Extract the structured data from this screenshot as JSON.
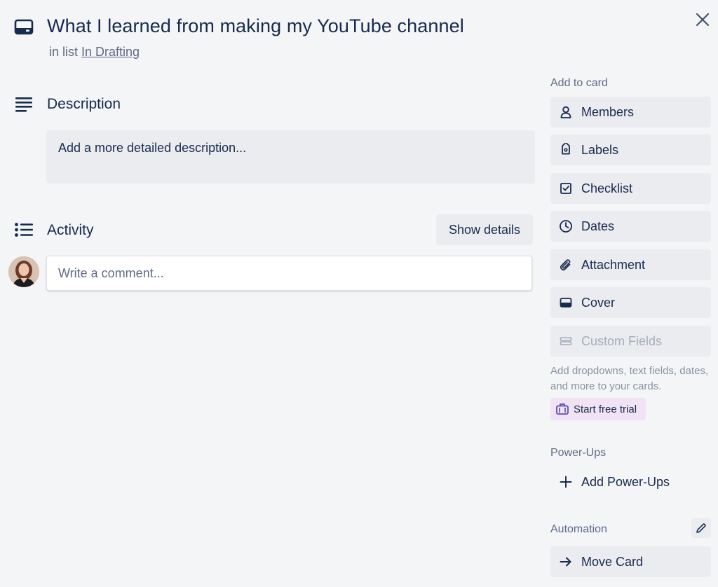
{
  "card": {
    "title": "What I learned from making my YouTube channel",
    "in_list_prefix": "in list",
    "list_name": "In Drafting"
  },
  "description": {
    "heading": "Description",
    "placeholder": "Add a more detailed description..."
  },
  "activity": {
    "heading": "Activity",
    "show_details_label": "Show details",
    "comment_placeholder": "Write a comment..."
  },
  "sidebar": {
    "add_to_card_heading": "Add to card",
    "buttons": [
      {
        "label": "Members",
        "icon": "person-icon"
      },
      {
        "label": "Labels",
        "icon": "tag-icon"
      },
      {
        "label": "Checklist",
        "icon": "checkbox-icon"
      },
      {
        "label": "Dates",
        "icon": "clock-icon"
      },
      {
        "label": "Attachment",
        "icon": "paperclip-icon"
      },
      {
        "label": "Cover",
        "icon": "cover-icon"
      },
      {
        "label": "Custom Fields",
        "icon": "custom-fields-icon",
        "disabled": true
      }
    ],
    "custom_fields_note": "Add dropdowns, text fields, dates, and more to your cards.",
    "start_trial_label": "Start free trial",
    "power_ups_heading": "Power-Ups",
    "add_power_ups_label": "Add Power-Ups",
    "automation_heading": "Automation",
    "move_card_label": "Move Card"
  },
  "colors": {
    "background": "#f4f5f7",
    "button_bg": "#ebecf0",
    "text": "#172b4d",
    "muted": "#5e6c84",
    "trial_bg": "#f1e2f4"
  }
}
